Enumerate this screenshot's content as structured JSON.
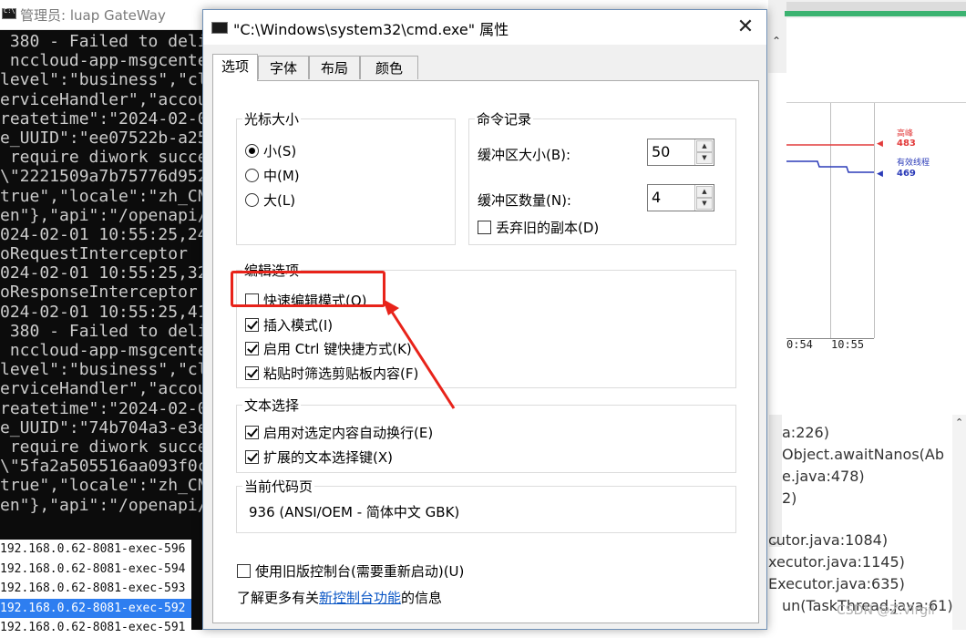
{
  "console": {
    "title": "管理员:  luap GateWay",
    "lines": [
      " 380 - Failed to deli",
      " nccloud-app-msgcente",
      "level\":\"business\",\"cl",
      "erviceHandler\",\"accou",
      "reatetime\":\"2024-02-0",
      "e_UUID\":\"ee07522b-a25",
      " require diwork succe",
      "\\\"2221509a7b75776d952",
      "true\",\"locale\":\"zh_CN",
      "en\"},\"api\":\"/openapi/",
      "024-02-01 10:55:25,24",
      "oRequestInterceptor  ",
      "024-02-01 10:55:25,32",
      "oResponseInterceptor ",
      "024-02-01 10:55:25,41",
      " 380 - Failed to deli",
      " nccloud-app-msgcente",
      "level\":\"business\",\"cl",
      "erviceHandler\",\"accou",
      "reatetime\":\"2024-02-0",
      "e_UUID\":\"74b704a3-e3e",
      " require diwork succe",
      "\\\"5fa2a505516aa093f0c",
      "true\",\"locale\":\"zh_CN",
      "en\"},\"api\":\"/openapi/"
    ],
    "bottom_lines": [
      "192.168.0.62-8081-exec-596",
      "192.168.0.62-8081-exec-594",
      "192.168.0.62-8081-exec-593",
      "192.168.0.62-8081-exec-592",
      "192.168.0.62-8081-exec-591"
    ]
  },
  "monitor": {
    "legend_peak": "高峰",
    "legend_peak_value": "483",
    "legend_active": "有效线程",
    "legend_active_value": "469",
    "x_ticks": [
      "0:54",
      "10:55"
    ],
    "peak_color": "#e23b3b",
    "active_color": "#2b3bb8"
  },
  "code_panel": {
    "lines": [
      "a:226)",
      "Object.awaitNanos(Ab",
      "e.java:478)",
      "2)",
      "cutor.java:1084)",
      "xecutor.java:1145)",
      "Executor.java:635)",
      "un(TaskThread.java:61)"
    ]
  },
  "watermark": "CSDN @Z.Virgil",
  "dialog": {
    "title": "\"C:\\Windows\\system32\\cmd.exe\" 属性",
    "close_label": "✕",
    "tabs": [
      "选项",
      "字体",
      "布局",
      "颜色"
    ],
    "cursor_size": {
      "legend": "光标大小",
      "options": [
        "小(S)",
        "中(M)",
        "大(L)"
      ],
      "selected": "小(S)"
    },
    "history": {
      "legend": "命令记录",
      "buffer_size_label": "缓冲区大小(B):",
      "buffer_size_value": "50",
      "buffer_count_label": "缓冲区数量(N):",
      "buffer_count_value": "4",
      "discard_label": "丢弃旧的副本(D)",
      "discard_checked": false
    },
    "edit_options": {
      "legend": "编辑选项",
      "items": [
        {
          "label": "快速编辑模式(Q)",
          "checked": false
        },
        {
          "label": "插入模式(I)",
          "checked": true
        },
        {
          "label": "启用 Ctrl 键快捷方式(K)",
          "checked": true
        },
        {
          "label": "粘贴时筛选剪贴板内容(F)",
          "checked": true
        }
      ]
    },
    "text_selection": {
      "legend": "文本选择",
      "items": [
        {
          "label": "启用对选定内容自动换行(E)",
          "checked": true
        },
        {
          "label": "扩展的文本选择键(X)",
          "checked": true
        }
      ]
    },
    "codepage": {
      "legend": "当前代码页",
      "value": "936   (ANSI/OEM - 简体中文 GBK)"
    },
    "legacy_console": {
      "label": "使用旧版控制台(需要重新启动)(U)",
      "checked": false
    },
    "learn_more": {
      "prefix": "了解更多有关",
      "link": "新控制台功能",
      "suffix": "的信息"
    },
    "annotation_color": "#e8231a"
  }
}
